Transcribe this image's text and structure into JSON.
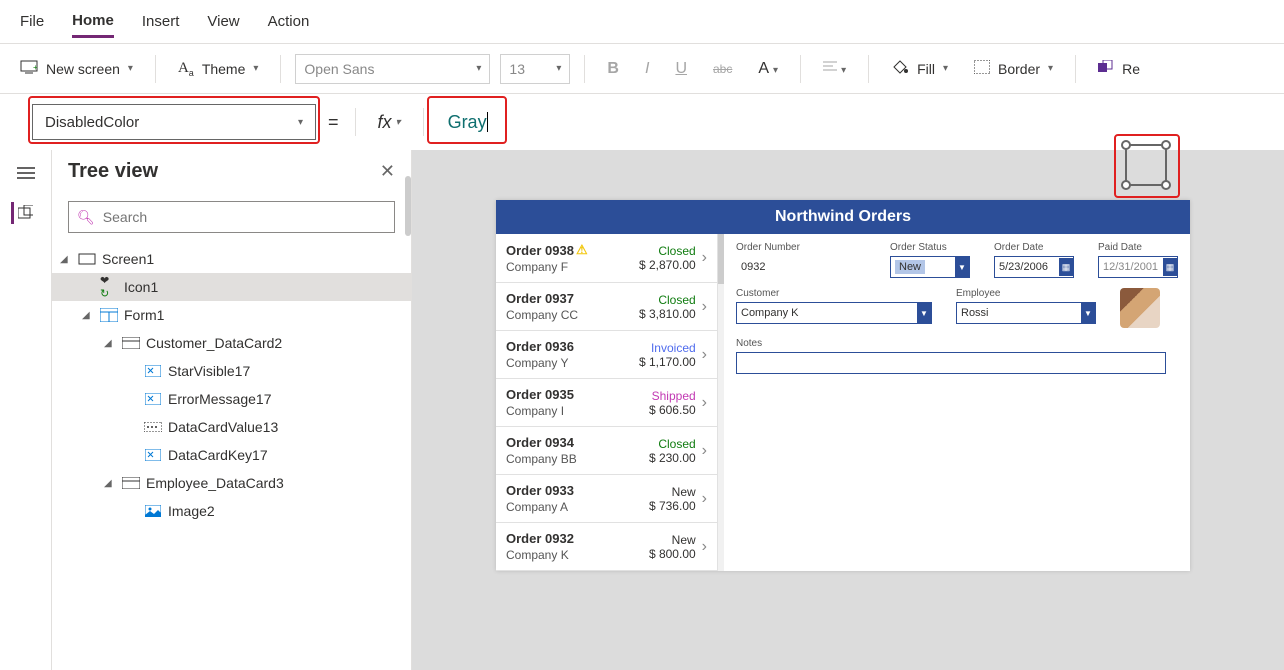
{
  "menu": [
    "File",
    "Home",
    "Insert",
    "View",
    "Action"
  ],
  "menuActive": 1,
  "ribbon": {
    "newScreen": "New screen",
    "theme": "Theme",
    "font": "Open Sans",
    "size": "13",
    "fill": "Fill",
    "border": "Border",
    "reorder": "Re"
  },
  "propSelector": "DisabledColor",
  "formula": "Gray",
  "treeTitle": "Tree view",
  "searchPlaceholder": "Search",
  "tree": [
    {
      "indent": 0,
      "exp": true,
      "icon": "screen",
      "label": "Screen1"
    },
    {
      "indent": 1,
      "exp": null,
      "icon": "icon",
      "label": "Icon1",
      "sel": true
    },
    {
      "indent": 1,
      "exp": true,
      "icon": "form",
      "label": "Form1"
    },
    {
      "indent": 2,
      "exp": true,
      "icon": "card",
      "label": "Customer_DataCard2"
    },
    {
      "indent": 3,
      "exp": null,
      "icon": "ctrl",
      "label": "StarVisible17"
    },
    {
      "indent": 3,
      "exp": null,
      "icon": "ctrl",
      "label": "ErrorMessage17"
    },
    {
      "indent": 3,
      "exp": null,
      "icon": "input",
      "label": "DataCardValue13"
    },
    {
      "indent": 3,
      "exp": null,
      "icon": "ctrl",
      "label": "DataCardKey17"
    },
    {
      "indent": 2,
      "exp": true,
      "icon": "card",
      "label": "Employee_DataCard3"
    },
    {
      "indent": 3,
      "exp": null,
      "icon": "image",
      "label": "Image2"
    }
  ],
  "app": {
    "title": "Northwind Orders",
    "orders": [
      {
        "id": "Order 0938",
        "company": "Company F",
        "status": "Closed",
        "stClass": "st-closed",
        "amount": "$ 2,870.00",
        "warn": true
      },
      {
        "id": "Order 0937",
        "company": "Company CC",
        "status": "Closed",
        "stClass": "st-closed",
        "amount": "$ 3,810.00"
      },
      {
        "id": "Order 0936",
        "company": "Company Y",
        "status": "Invoiced",
        "stClass": "st-invoiced",
        "amount": "$ 1,170.00"
      },
      {
        "id": "Order 0935",
        "company": "Company I",
        "status": "Shipped",
        "stClass": "st-shipped",
        "amount": "$ 606.50"
      },
      {
        "id": "Order 0934",
        "company": "Company BB",
        "status": "Closed",
        "stClass": "st-closed",
        "amount": "$ 230.00"
      },
      {
        "id": "Order 0933",
        "company": "Company A",
        "status": "New",
        "stClass": "st-new",
        "amount": "$ 736.00"
      },
      {
        "id": "Order 0932",
        "company": "Company K",
        "status": "New",
        "stClass": "st-new",
        "amount": "$ 800.00"
      }
    ],
    "detail": {
      "labels": {
        "orderNumber": "Order Number",
        "orderStatus": "Order Status",
        "orderDate": "Order Date",
        "paidDate": "Paid Date",
        "customer": "Customer",
        "employee": "Employee",
        "notes": "Notes"
      },
      "orderNumber": "0932",
      "orderStatus": "New",
      "orderDate": "5/23/2006",
      "paidDate": "12/31/2001",
      "customer": "Company K",
      "employee": "Rossi"
    }
  }
}
